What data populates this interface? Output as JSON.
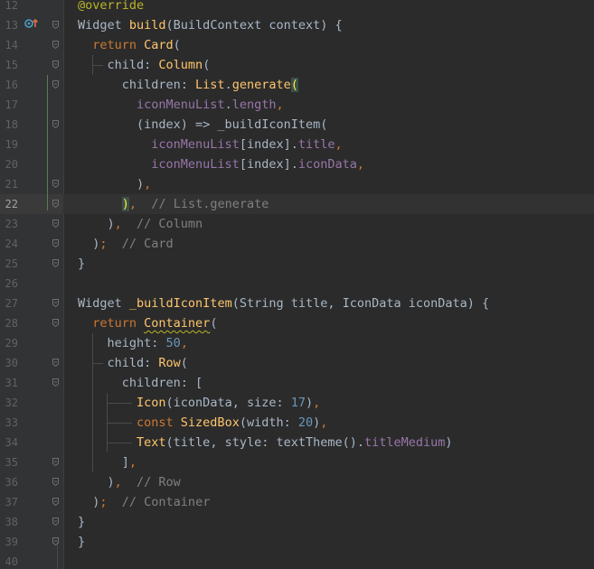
{
  "editor": {
    "current_line": 22,
    "lines": [
      {
        "n": "12",
        "tokens": [
          {
            "t": "@override",
            "c": "ann"
          }
        ]
      },
      {
        "n": "13",
        "tokens": [
          {
            "t": "Widget ",
            "c": "plain"
          },
          {
            "t": "build",
            "c": "fn"
          },
          {
            "t": "(BuildContext context) {",
            "c": "plain"
          }
        ]
      },
      {
        "n": "14",
        "tokens": [
          {
            "t": "  return ",
            "c": "kw"
          },
          {
            "t": "Card",
            "c": "cls"
          },
          {
            "t": "(",
            "c": "plain"
          }
        ]
      },
      {
        "n": "15",
        "tokens": [
          {
            "t": "    child: ",
            "c": "plain"
          },
          {
            "t": "Column",
            "c": "cls"
          },
          {
            "t": "(",
            "c": "plain"
          }
        ]
      },
      {
        "n": "16",
        "tokens": [
          {
            "t": "      children: ",
            "c": "plain"
          },
          {
            "t": "List",
            "c": "cls"
          },
          {
            "t": ".",
            "c": "plain"
          },
          {
            "t": "generate",
            "c": "fn"
          },
          {
            "t": "(",
            "c": "brace"
          }
        ]
      },
      {
        "n": "17",
        "tokens": [
          {
            "t": "        ",
            "c": "plain"
          },
          {
            "t": "iconMenuList",
            "c": "prop"
          },
          {
            "t": ".",
            "c": "plain"
          },
          {
            "t": "length",
            "c": "prop"
          },
          {
            "t": ",",
            "c": "punc"
          }
        ]
      },
      {
        "n": "18",
        "tokens": [
          {
            "t": "        (index) => _buildIconItem(",
            "c": "plain"
          }
        ]
      },
      {
        "n": "19",
        "tokens": [
          {
            "t": "          ",
            "c": "plain"
          },
          {
            "t": "iconMenuList",
            "c": "prop"
          },
          {
            "t": "[index].",
            "c": "plain"
          },
          {
            "t": "title",
            "c": "prop"
          },
          {
            "t": ",",
            "c": "punc"
          }
        ]
      },
      {
        "n": "20",
        "tokens": [
          {
            "t": "          ",
            "c": "plain"
          },
          {
            "t": "iconMenuList",
            "c": "prop"
          },
          {
            "t": "[index].",
            "c": "plain"
          },
          {
            "t": "iconData",
            "c": "prop"
          },
          {
            "t": ",",
            "c": "punc"
          }
        ]
      },
      {
        "n": "21",
        "tokens": [
          {
            "t": "        )",
            "c": "plain"
          },
          {
            "t": ",",
            "c": "punc"
          }
        ]
      },
      {
        "n": "22",
        "tokens": [
          {
            "t": "      ",
            "c": "plain"
          },
          {
            "t": ")",
            "c": "brace"
          },
          {
            "t": ",",
            "c": "punc"
          },
          {
            "t": "  // List.generate",
            "c": "cmt"
          }
        ]
      },
      {
        "n": "23",
        "tokens": [
          {
            "t": "    )",
            "c": "plain"
          },
          {
            "t": ",",
            "c": "punc"
          },
          {
            "t": "  // Column",
            "c": "cmt"
          }
        ]
      },
      {
        "n": "24",
        "tokens": [
          {
            "t": "  )",
            "c": "plain"
          },
          {
            "t": ";",
            "c": "punc"
          },
          {
            "t": "  // Card",
            "c": "cmt"
          }
        ]
      },
      {
        "n": "25",
        "tokens": [
          {
            "t": "}",
            "c": "plain"
          }
        ]
      },
      {
        "n": "26",
        "tokens": []
      },
      {
        "n": "27",
        "tokens": [
          {
            "t": "Widget ",
            "c": "plain"
          },
          {
            "t": "_buildIconItem",
            "c": "fn"
          },
          {
            "t": "(String title, IconData iconData) {",
            "c": "plain"
          }
        ]
      },
      {
        "n": "28",
        "tokens": [
          {
            "t": "  return ",
            "c": "kw"
          },
          {
            "t": "Container",
            "c": "cls squiggle"
          },
          {
            "t": "(",
            "c": "plain"
          }
        ]
      },
      {
        "n": "29",
        "tokens": [
          {
            "t": "    height: ",
            "c": "plain"
          },
          {
            "t": "50",
            "c": "num"
          },
          {
            "t": ",",
            "c": "punc"
          }
        ]
      },
      {
        "n": "30",
        "tokens": [
          {
            "t": "    child: ",
            "c": "plain"
          },
          {
            "t": "Row",
            "c": "cls"
          },
          {
            "t": "(",
            "c": "plain"
          }
        ]
      },
      {
        "n": "31",
        "tokens": [
          {
            "t": "      children: [",
            "c": "plain"
          }
        ]
      },
      {
        "n": "32",
        "tokens": [
          {
            "t": "        ",
            "c": "plain"
          },
          {
            "t": "Icon",
            "c": "cls"
          },
          {
            "t": "(iconData, size: ",
            "c": "plain"
          },
          {
            "t": "17",
            "c": "num"
          },
          {
            "t": ")",
            "c": "plain"
          },
          {
            "t": ",",
            "c": "punc"
          }
        ]
      },
      {
        "n": "33",
        "tokens": [
          {
            "t": "        const ",
            "c": "kw"
          },
          {
            "t": "SizedBox",
            "c": "cls"
          },
          {
            "t": "(width: ",
            "c": "plain"
          },
          {
            "t": "20",
            "c": "num"
          },
          {
            "t": ")",
            "c": "plain"
          },
          {
            "t": ",",
            "c": "punc"
          }
        ]
      },
      {
        "n": "34",
        "tokens": [
          {
            "t": "        ",
            "c": "plain"
          },
          {
            "t": "Text",
            "c": "cls"
          },
          {
            "t": "(title, style: textTheme().",
            "c": "plain"
          },
          {
            "t": "titleMedium",
            "c": "prop"
          },
          {
            "t": ")",
            "c": "plain"
          }
        ]
      },
      {
        "n": "35",
        "tokens": [
          {
            "t": "      ]",
            "c": "plain"
          },
          {
            "t": ",",
            "c": "punc"
          }
        ]
      },
      {
        "n": "36",
        "tokens": [
          {
            "t": "    )",
            "c": "plain"
          },
          {
            "t": ",",
            "c": "punc"
          },
          {
            "t": "  // Row",
            "c": "cmt"
          }
        ]
      },
      {
        "n": "37",
        "tokens": [
          {
            "t": "  )",
            "c": "plain"
          },
          {
            "t": ";",
            "c": "punc"
          },
          {
            "t": "  // Container",
            "c": "cmt"
          }
        ]
      },
      {
        "n": "38",
        "tokens": [
          {
            "t": "}",
            "c": "plain"
          }
        ]
      },
      {
        "n": "39",
        "tokens": [
          {
            "t": "}",
            "c": "plain"
          }
        ]
      },
      {
        "n": "40",
        "tokens": []
      }
    ],
    "folds": [
      "13",
      "14",
      "15",
      "16",
      "18",
      "21",
      "22",
      "23",
      "24",
      "25",
      "27",
      "28",
      "30",
      "31",
      "35",
      "36",
      "37",
      "38",
      "39"
    ],
    "icons": {
      "override_marker": "override-method-icon",
      "override_line": "13"
    },
    "colors": {
      "background": "#2b2b2b",
      "keyword": "#cc7832",
      "class": "#ffc66d",
      "property": "#9876aa",
      "number": "#6897bb",
      "comment": "#808080",
      "annotation": "#bbb529"
    }
  }
}
